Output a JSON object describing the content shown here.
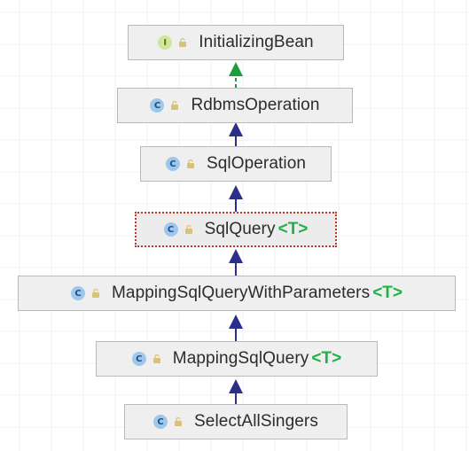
{
  "diagram": {
    "nodes": [
      {
        "id": "initializing-bean",
        "kind": "interface",
        "badge": "I",
        "name": "InitializingBean",
        "type_param": "",
        "selected": false
      },
      {
        "id": "rdbms-operation",
        "kind": "class",
        "badge": "C",
        "name": "RdbmsOperation",
        "type_param": "",
        "selected": false
      },
      {
        "id": "sql-operation",
        "kind": "class",
        "badge": "C",
        "name": "SqlOperation",
        "type_param": "",
        "selected": false
      },
      {
        "id": "sql-query",
        "kind": "class",
        "badge": "C",
        "name": "SqlQuery",
        "type_param": "<T>",
        "selected": true
      },
      {
        "id": "mapping-sql-query-with-parameters",
        "kind": "class",
        "badge": "C",
        "name": "MappingSqlQueryWithParameters",
        "type_param": "<T>",
        "selected": false
      },
      {
        "id": "mapping-sql-query",
        "kind": "class",
        "badge": "C",
        "name": "MappingSqlQuery",
        "type_param": "<T>",
        "selected": false
      },
      {
        "id": "select-all-singers",
        "kind": "class",
        "badge": "C",
        "name": "SelectAllSingers",
        "type_param": "",
        "selected": false
      }
    ],
    "edges": [
      {
        "from": "rdbms-operation",
        "to": "initializing-bean",
        "type": "implements"
      },
      {
        "from": "sql-operation",
        "to": "rdbms-operation",
        "type": "extends"
      },
      {
        "from": "sql-query",
        "to": "sql-operation",
        "type": "extends"
      },
      {
        "from": "mapping-sql-query-with-parameters",
        "to": "sql-query",
        "type": "extends"
      },
      {
        "from": "mapping-sql-query",
        "to": "mapping-sql-query-with-parameters",
        "type": "extends"
      },
      {
        "from": "select-all-singers",
        "to": "mapping-sql-query",
        "type": "extends"
      }
    ],
    "colors": {
      "class_badge": "#9fc7ec",
      "interface_badge": "#d2e59b",
      "extends_arrow": "#2b2f87",
      "implements_arrow": "#1f9d3c",
      "type_param": "#21b14a",
      "selection_border": "#c0392b",
      "lock_icon": "#d8c27a"
    }
  }
}
